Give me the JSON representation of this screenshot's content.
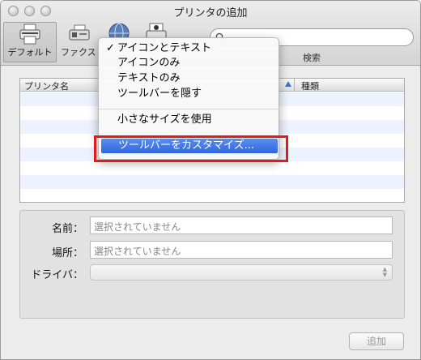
{
  "window": {
    "title": "プリンタの追加"
  },
  "toolbar": {
    "default_label": "デフォルト",
    "fax_label": "ファクス",
    "search_placeholder": "",
    "search_label": "検索"
  },
  "list": {
    "columns": [
      "プリンタ名",
      "種類"
    ],
    "rows": []
  },
  "form": {
    "name_label": "名前：",
    "name_value": "選択されていません",
    "location_label": "場所：",
    "location_value": "選択されていません",
    "driver_label": "ドライバ：",
    "driver_value": ""
  },
  "buttons": {
    "add": "追加"
  },
  "context_menu": {
    "check_mark": "✓",
    "items": [
      "アイコンとテキスト",
      "アイコンのみ",
      "テキストのみ",
      "ツールバーを隠す",
      "小さなサイズを使用",
      "ツールバーをカスタマイズ..."
    ],
    "checked_index": 0,
    "selected_index": 5
  },
  "colors": {
    "selection": "#2f66dd",
    "highlight_frame": "#e01b1b",
    "row_alt": "#edf3fe"
  }
}
